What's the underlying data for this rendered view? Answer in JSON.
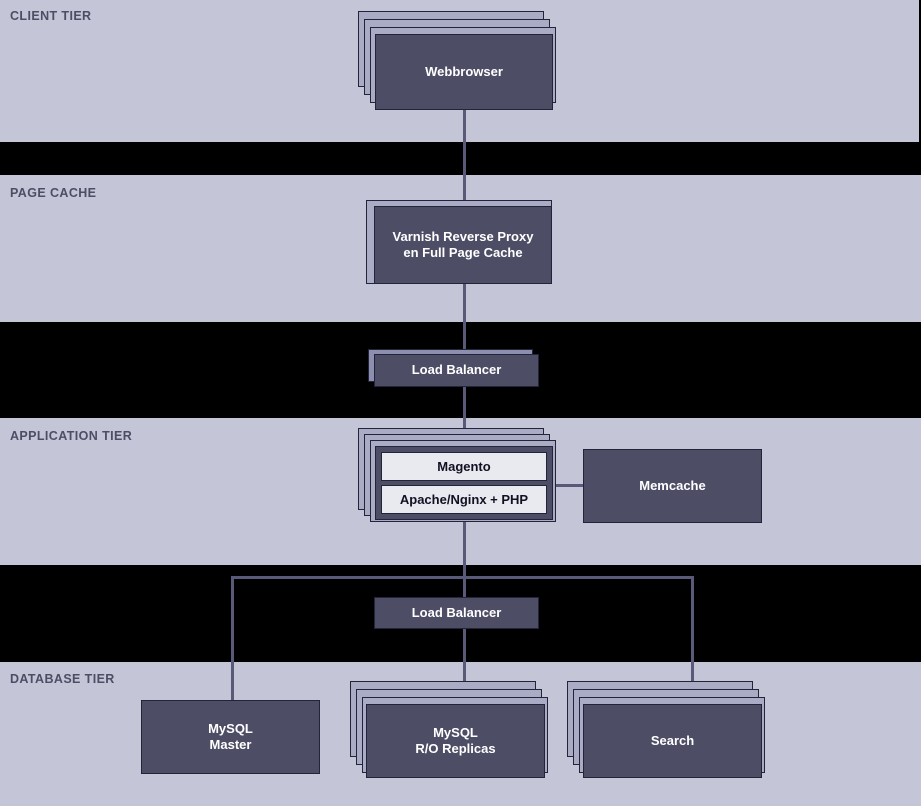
{
  "theme": {
    "band_bg": "#c4c5d7",
    "page_bg": "#000000",
    "node_fill": "#4d4e66",
    "node_border": "#23243a",
    "sheet_fill": "#aaabc4",
    "slab_fill": "#8d8fae",
    "pane_fill": "#e9e9f0",
    "line_color": "#585a78",
    "label_color": "#4d4e66",
    "node_text": "#ffffff",
    "pane_text": "#111122"
  },
  "tiers": [
    {
      "id": "client",
      "label": "CLIENT TIER"
    },
    {
      "id": "page_cache",
      "label": "PAGE CACHE"
    },
    {
      "id": "application",
      "label": "APPLICATION TIER"
    },
    {
      "id": "database",
      "label": "DATABASE TIER"
    }
  ],
  "nodes": {
    "webbrowser": {
      "label": "Webbrowser"
    },
    "varnish": {
      "label": "Varnish Reverse Proxy\nen Full Page Cache"
    },
    "lb_top": {
      "label": "Load Balancer"
    },
    "magento": {
      "label": "Magento"
    },
    "apache_php": {
      "label": "Apache/Nginx + PHP"
    },
    "memcache": {
      "label": "Memcache"
    },
    "lb_db": {
      "label": "Load Balancer"
    },
    "mysql_master": {
      "label": "MySQL\nMaster"
    },
    "mysql_ro": {
      "label": "MySQL\nR/O Replicas"
    },
    "search": {
      "label": "Search"
    }
  }
}
